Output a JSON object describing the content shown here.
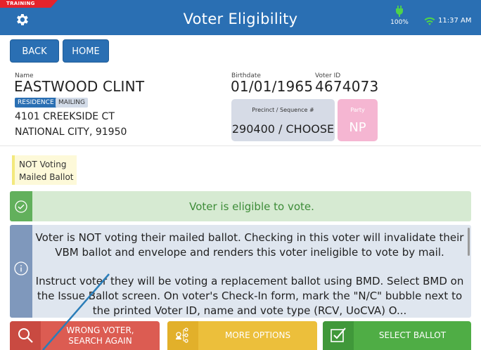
{
  "header": {
    "training_badge": "TRAINING",
    "title": "Voter Eligibility",
    "battery": "100%",
    "time": "11:37 AM",
    "accent_color": "#2a6fb3"
  },
  "nav": {
    "back_label": "BACK",
    "home_label": "HOME"
  },
  "voter": {
    "name_label": "Name",
    "name": "EASTWOOD CLINT",
    "birthdate_label": "Birthdate",
    "birthdate": "01/01/1965",
    "voter_id_label": "Voter ID",
    "voter_id": "4674073",
    "address_tabs": [
      "RESIDENCE",
      "MAILING"
    ],
    "address_line1": "4101 CREEKSIDE  CT",
    "address_line2": "NATIONAL CITY, 91950",
    "precinct_label": "Precinct / Sequence #",
    "precinct_value": "290400 / CHOOSE",
    "party_label": "Party",
    "party_value": "NP"
  },
  "status": {
    "line1": "NOT Voting",
    "line2": "Mailed Ballot"
  },
  "eligibility": {
    "message": "Voter is eligible to vote.",
    "color": "#62b05c"
  },
  "info": {
    "paragraph1": "Voter is NOT voting their mailed ballot. Checking in this voter will invalidate their VBM ballot and envelope and renders this voter ineligible to vote by mail.",
    "paragraph2": "Instruct voter they will be voting a replacement ballot using BMD. Select BMD on the Issue Ballot screen. On voter's Check-In form, mark the \"N/C\" bubble next to the printed Voter ID, name and vote type (RCV, UoCVA) O..."
  },
  "actions": {
    "wrong_voter_line1": "WRONG VOTER,",
    "wrong_voter_line2": "SEARCH AGAIN",
    "more_options": "MORE OPTIONS",
    "select_ballot": "SELECT BALLOT"
  }
}
